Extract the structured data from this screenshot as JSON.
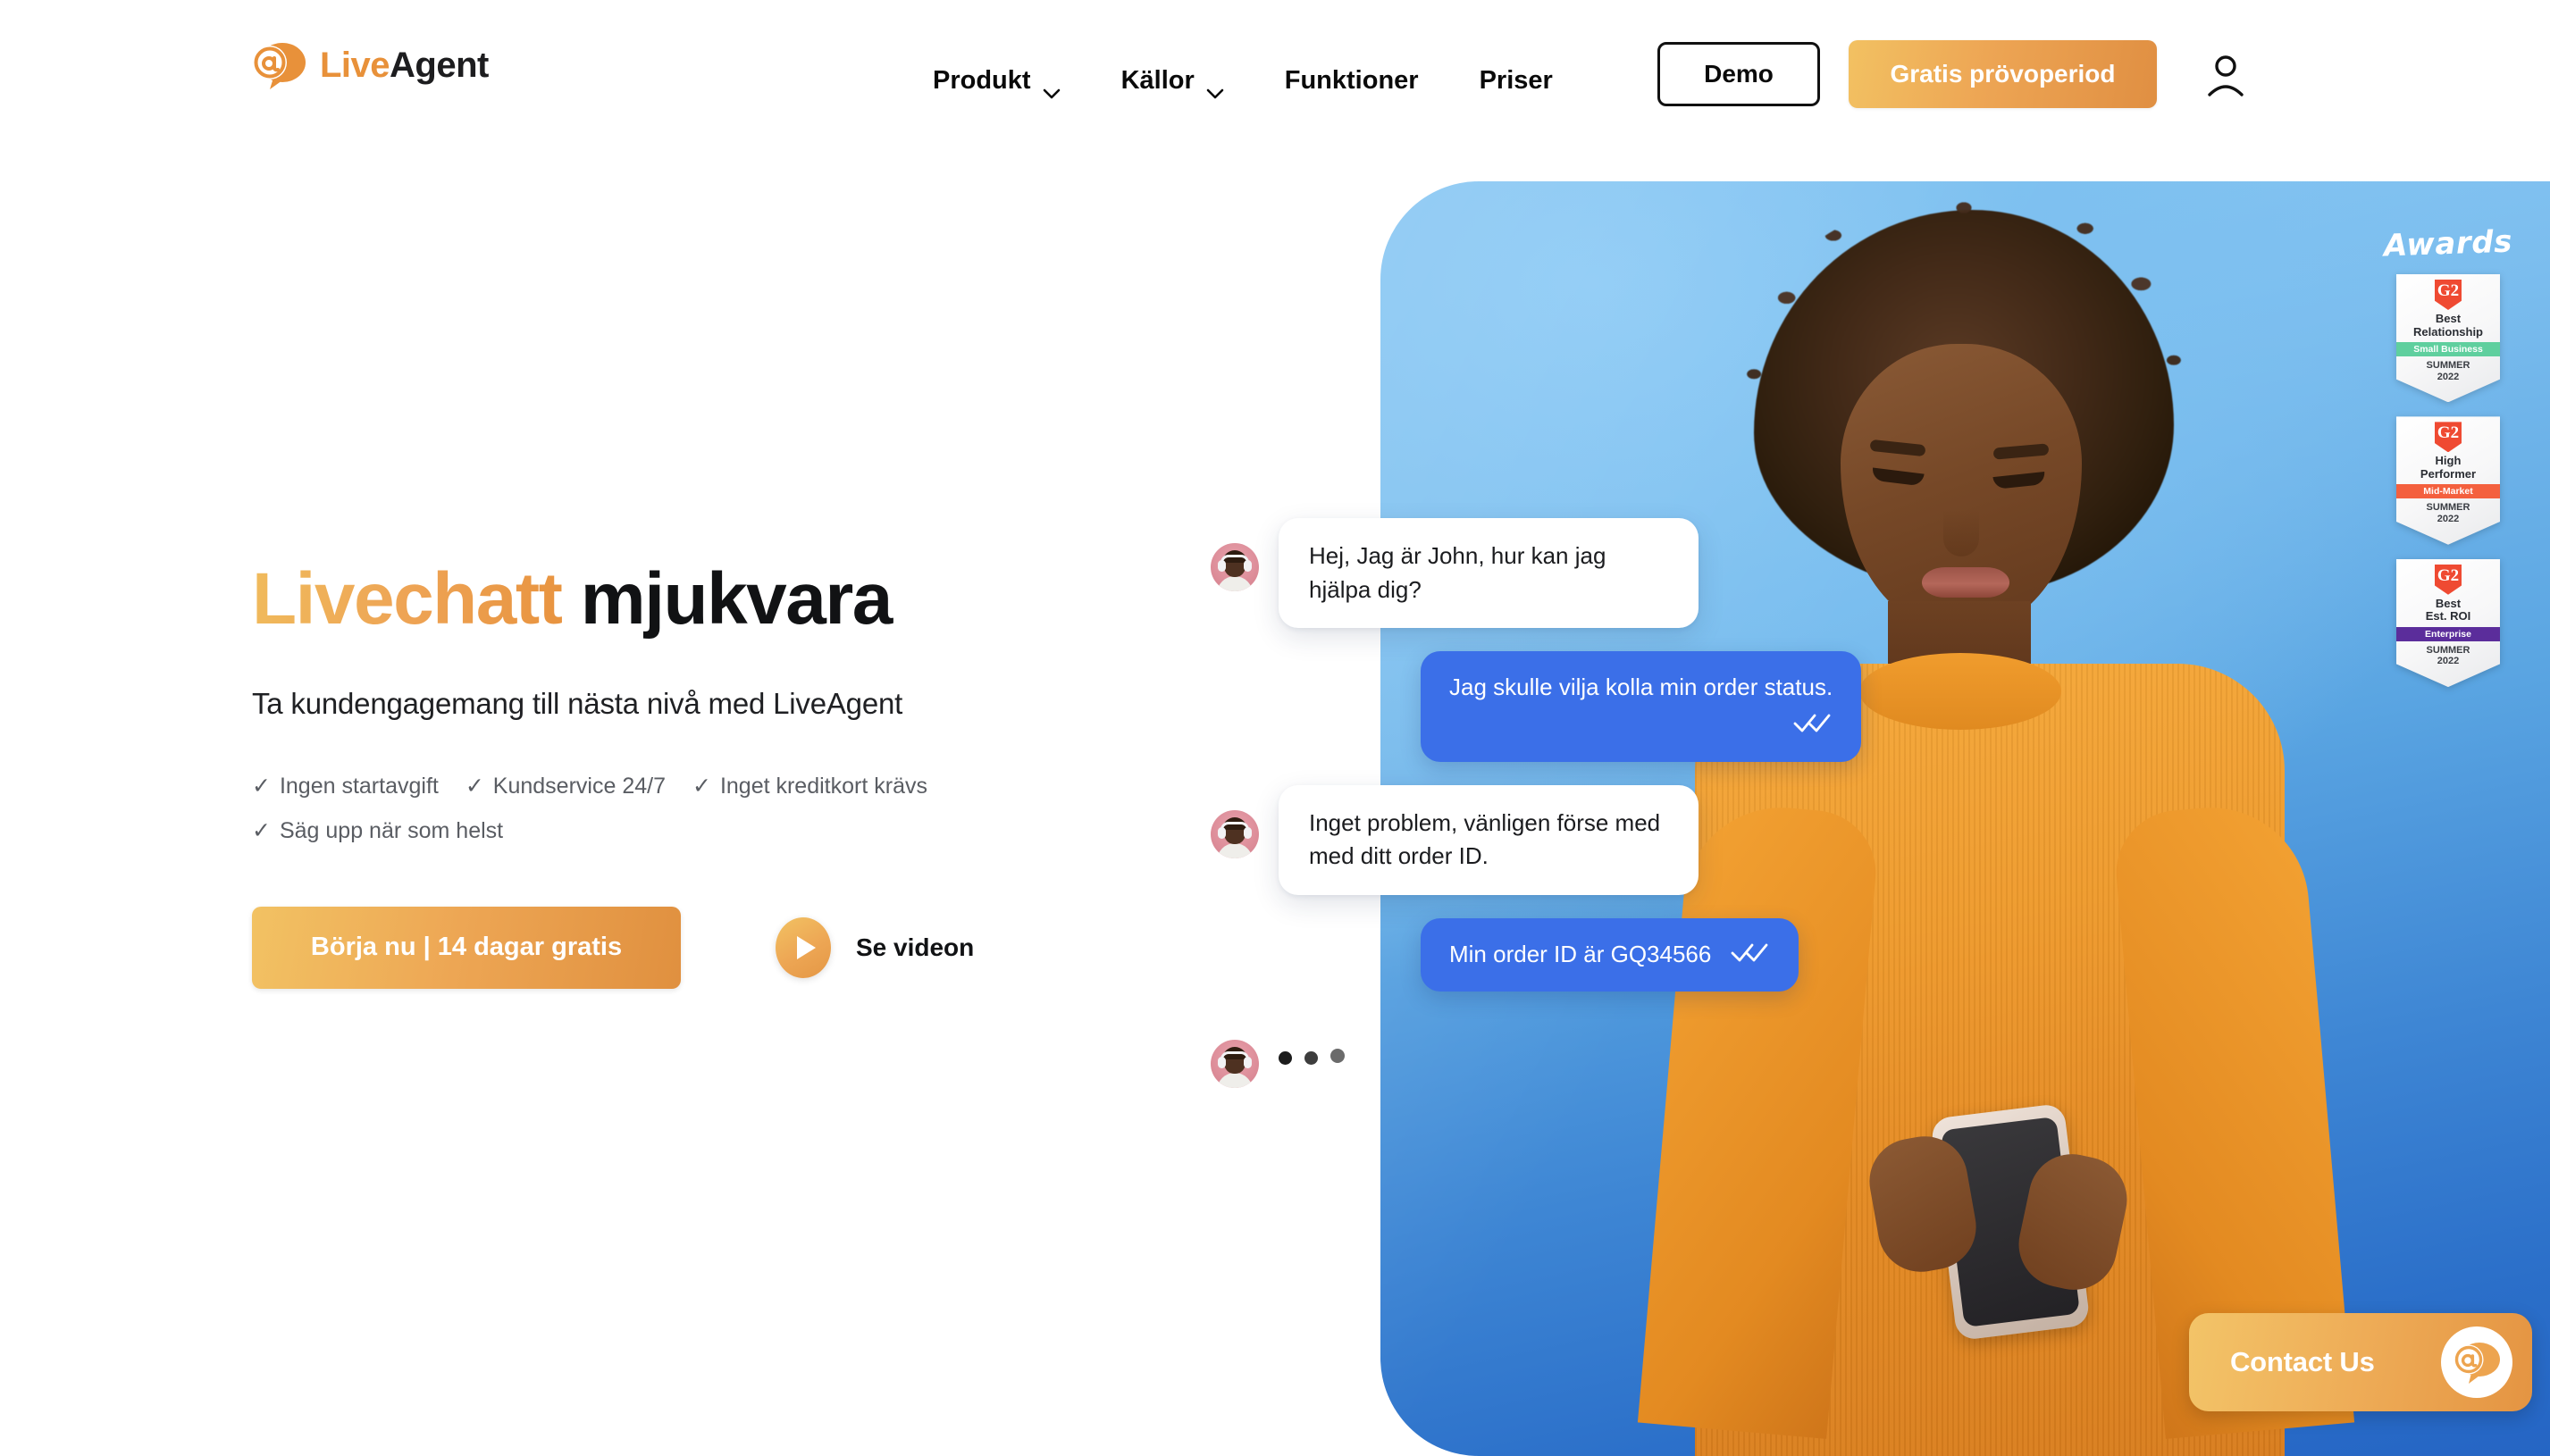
{
  "brand": {
    "logo_live": "Live",
    "logo_agent": "Agent",
    "accent_orange": "#e8913a",
    "accent_blue": "#3b6fe8"
  },
  "header": {
    "nav": [
      {
        "label": "Produkt",
        "has_dropdown": true,
        "icon": "chevron-down-icon"
      },
      {
        "label": "Källor",
        "has_dropdown": true,
        "icon": "chevron-down-icon"
      },
      {
        "label": "Funktioner",
        "has_dropdown": false
      },
      {
        "label": "Priser",
        "has_dropdown": false
      }
    ],
    "demo_label": "Demo",
    "trial_label": "Gratis prövoperiod",
    "account_icon": "user-icon"
  },
  "hero": {
    "title_accent": "Livechatt",
    "title_plain": "mjukvara",
    "subtitle": "Ta kundengagemang till nästa nivå med LiveAgent",
    "tick": "✓",
    "features_row1": [
      "Ingen startavgift",
      "Kundservice 24/7",
      "Inget kreditkort krävs"
    ],
    "features_row2": [
      "Säg upp när som helst"
    ],
    "cta_primary": "Börja nu | 14 dagar gratis",
    "cta_video": "Se videon",
    "play_icon": "play-icon"
  },
  "awards": {
    "heading": "Awards",
    "badges": [
      {
        "brand": "G2",
        "title_line1": "Best",
        "title_line2": "Relationship",
        "segment": "Small Business",
        "segment_color": "#5fcf9e",
        "season": "SUMMER",
        "year": "2022"
      },
      {
        "brand": "G2",
        "title_line1": "High",
        "title_line2": "Performer",
        "segment": "Mid-Market",
        "segment_color": "#f4603e",
        "season": "SUMMER",
        "year": "2022"
      },
      {
        "brand": "G2",
        "title_line1": "Best",
        "title_line2": "Est. ROI",
        "segment": "Enterprise",
        "segment_color": "#5b2d9b",
        "season": "SUMMER",
        "year": "2022"
      }
    ]
  },
  "chat": {
    "messages": [
      {
        "from": "agent",
        "text": "Hej, Jag är John, hur kan jag hjälpa dig?",
        "avatar": "agent-avatar",
        "read": false
      },
      {
        "from": "customer",
        "text": "Jag skulle vilja kolla min order status.",
        "read": true,
        "read_icon": "double-check-icon"
      },
      {
        "from": "agent",
        "text": "Inget problem, vänligen förse med med ditt order ID.",
        "avatar": "agent-avatar",
        "read": false
      },
      {
        "from": "customer",
        "text": "Min order ID är GQ34566",
        "read": true,
        "read_icon": "double-check-icon"
      },
      {
        "from": "agent",
        "text": "",
        "avatar": "agent-avatar",
        "typing": true
      }
    ]
  },
  "contact_widget": {
    "label": "Contact Us",
    "icon": "liveagent-chat-icon"
  }
}
